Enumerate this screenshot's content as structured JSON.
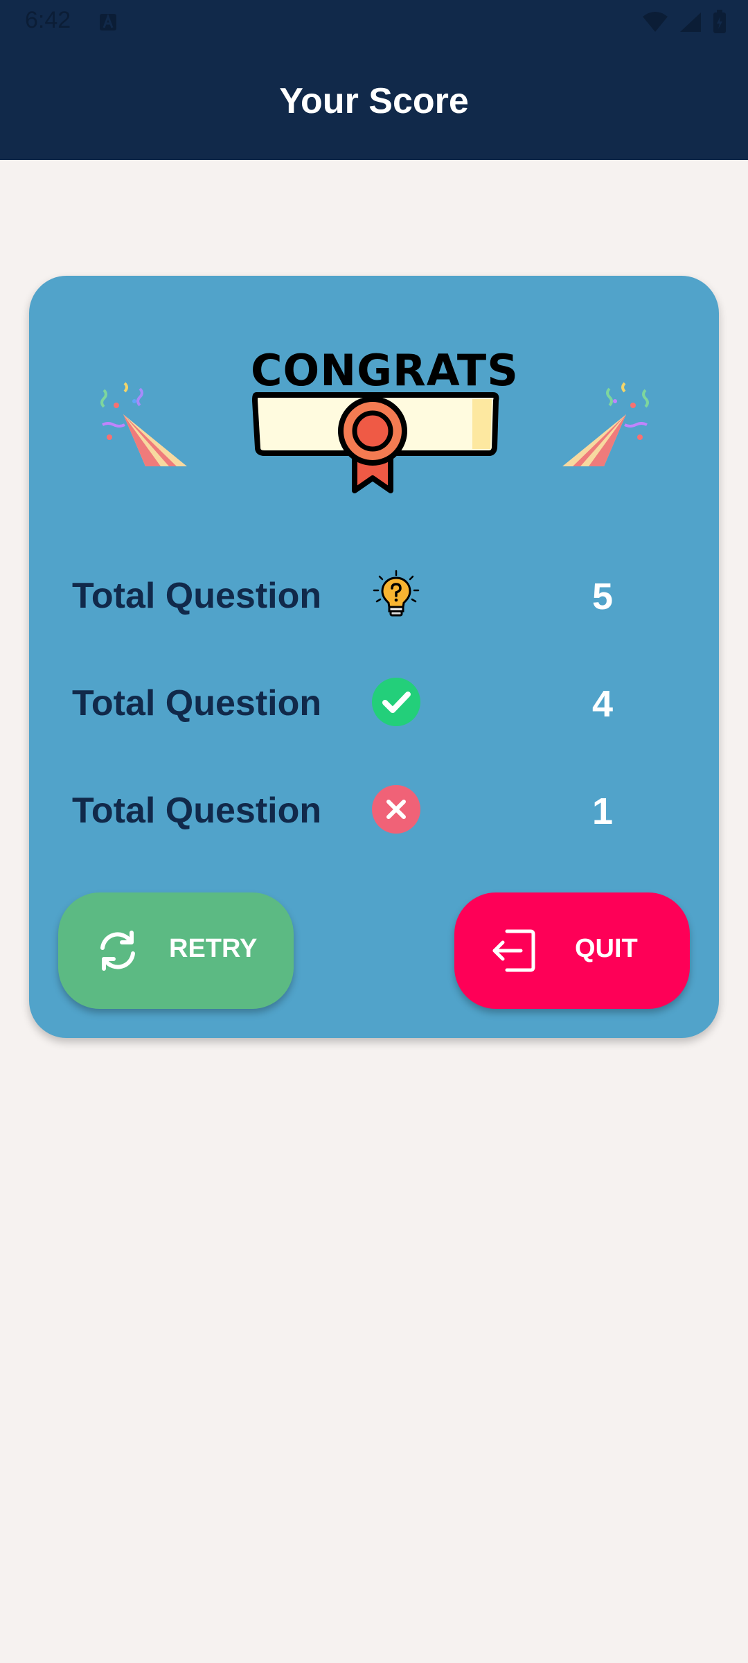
{
  "status_bar": {
    "time": "6:42"
  },
  "app_bar": {
    "title": "Your Score"
  },
  "card": {
    "badge_text": "CONGRATS",
    "rows": [
      {
        "label": "Total Question",
        "icon": "lightbulb-question-icon",
        "value": "5"
      },
      {
        "label": "Total Question",
        "icon": "check-circle-icon",
        "value": "4"
      },
      {
        "label": "Total Question",
        "icon": "x-circle-icon",
        "value": "1"
      }
    ],
    "retry_label": "RETRY",
    "quit_label": "QUIT"
  },
  "colors": {
    "header": "#11294a",
    "card": "#51a3ca",
    "retry": "#5cba83",
    "quit": "#fe0057",
    "background": "#f6f2f0"
  }
}
